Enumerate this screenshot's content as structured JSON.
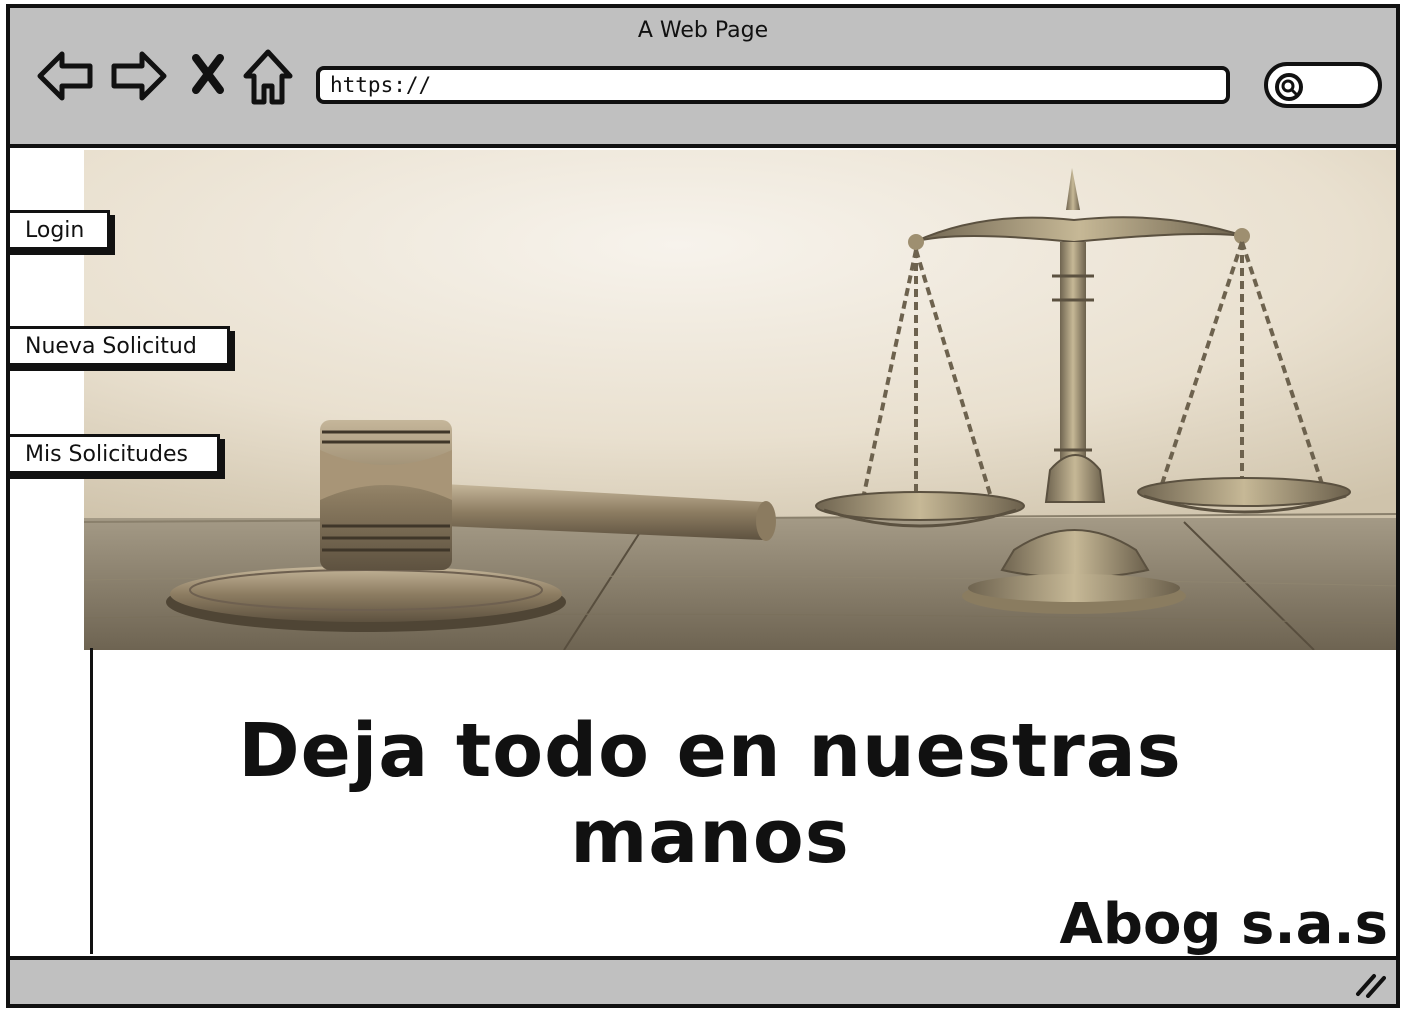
{
  "window": {
    "title": "A Web Page"
  },
  "toolbar": {
    "back_icon": "back-arrow-icon",
    "forward_icon": "forward-arrow-icon",
    "stop_icon": "close-icon",
    "home_icon": "home-icon",
    "url": "https://",
    "search_icon": "search-icon"
  },
  "sidebar": {
    "items": [
      {
        "label": "Login"
      },
      {
        "label": "Nueva Solicitud"
      },
      {
        "label": "Mis Solicitudes"
      }
    ]
  },
  "hero": {
    "image": "gavel-and-scales-of-justice-photo"
  },
  "main": {
    "headline": "Deja todo en nuestras manos",
    "brand": "Abog s.a.s"
  },
  "colors": {
    "chrome": "#c0c0c0",
    "ink": "#111111",
    "sepia_light": "#ece4d4",
    "sepia_dark": "#6e6452"
  }
}
